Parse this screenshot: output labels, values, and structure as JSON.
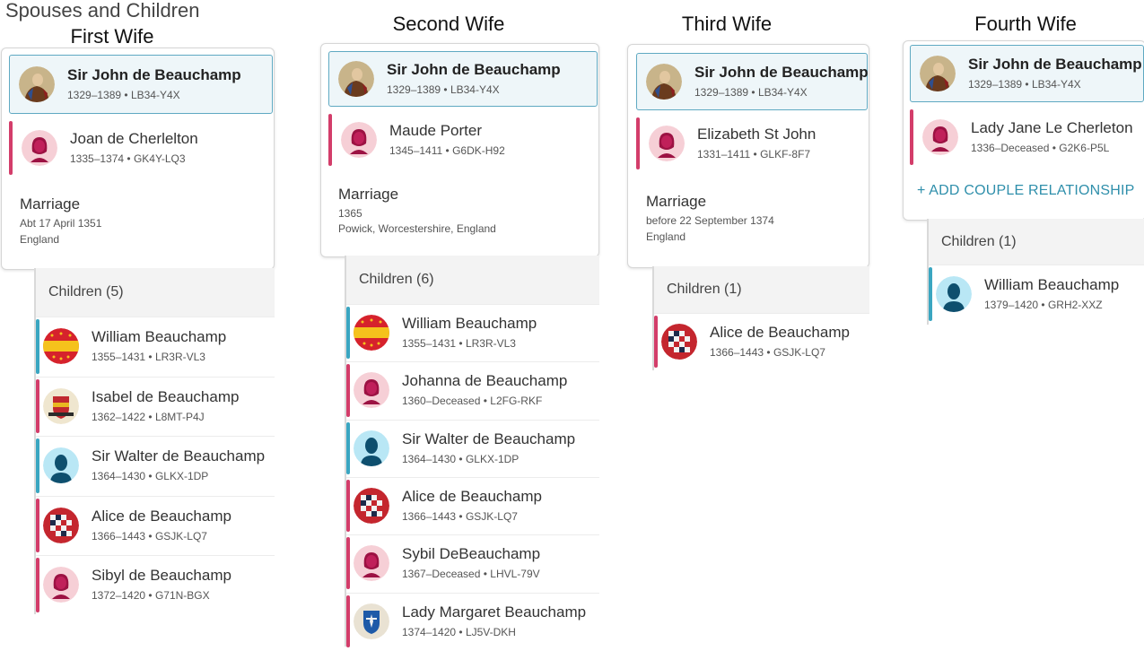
{
  "page_title": "Spouses and Children",
  "colors": {
    "female": "#d33d6a",
    "male": "#3aa6c1",
    "link": "#2f8fab",
    "focus_border": "#5fa9c2"
  },
  "columns": [
    {
      "title": "First Wife",
      "focus": {
        "name": "Sir John de Beauchamp",
        "years": "1329–1389",
        "id": "LB34-Y4X",
        "avatar": "portrait-icon"
      },
      "spouse": {
        "name": "Joan de Cherlelton",
        "years": "1335–1374",
        "id": "GK4Y-LQ3",
        "avatar": "female-silhouette-icon"
      },
      "marriage": {
        "label": "Marriage",
        "date": "Abt 17 April 1351",
        "place": "England"
      },
      "children_label": "Children (5)",
      "children": [
        {
          "name": "William Beauchamp",
          "years": "1355–1431",
          "id": "LR3R-VL3",
          "gender": "male",
          "avatar": "coat-of-arms-icon"
        },
        {
          "name": "Isabel de Beauchamp",
          "years": "1362–1422",
          "id": "L8MT-P4J",
          "gender": "female",
          "avatar": "heraldic-crest-icon"
        },
        {
          "name": "Sir Walter de Beauchamp",
          "years": "1364–1430",
          "id": "GLKX-1DP",
          "gender": "male",
          "avatar": "male-silhouette-icon"
        },
        {
          "name": "Alice de Beauchamp",
          "years": "1366–1443",
          "id": "GSJK-LQ7",
          "gender": "female",
          "avatar": "checkered-shield-icon"
        },
        {
          "name": "Sibyl de Beauchamp",
          "years": "1372–1420",
          "id": "G71N-BGX",
          "gender": "female",
          "avatar": "female-silhouette-icon"
        }
      ]
    },
    {
      "title": "Second Wife",
      "focus": {
        "name": "Sir John de Beauchamp",
        "years": "1329–1389",
        "id": "LB34-Y4X",
        "avatar": "portrait-icon"
      },
      "spouse": {
        "name": "Maude Porter",
        "years": "1345–1411",
        "id": "G6DK-H92",
        "avatar": "female-silhouette-icon"
      },
      "marriage": {
        "label": "Marriage",
        "date": "1365",
        "place": "Powick, Worcestershire, England"
      },
      "children_label": "Children (6)",
      "children": [
        {
          "name": "William Beauchamp",
          "years": "1355–1431",
          "id": "LR3R-VL3",
          "gender": "male",
          "avatar": "coat-of-arms-icon"
        },
        {
          "name": "Johanna de Beauchamp",
          "years": "1360–Deceased",
          "id": "L2FG-RKF",
          "gender": "female",
          "avatar": "female-silhouette-icon"
        },
        {
          "name": "Sir Walter de Beauchamp",
          "years": "1364–1430",
          "id": "GLKX-1DP",
          "gender": "male",
          "avatar": "male-silhouette-icon"
        },
        {
          "name": "Alice de Beauchamp",
          "years": "1366–1443",
          "id": "GSJK-LQ7",
          "gender": "female",
          "avatar": "checkered-shield-icon"
        },
        {
          "name": "Sybil DeBeauchamp",
          "years": "1367–Deceased",
          "id": "LHVL-79V",
          "gender": "female",
          "avatar": "female-silhouette-icon"
        },
        {
          "name": "Lady Margaret Beauchamp",
          "years": "1374–1420",
          "id": "LJ5V-DKH",
          "gender": "female",
          "avatar": "blue-crest-icon"
        }
      ]
    },
    {
      "title": "Third Wife",
      "focus": {
        "name": "Sir John de Beauchamp",
        "years": "1329–1389",
        "id": "LB34-Y4X",
        "avatar": "portrait-icon"
      },
      "spouse": {
        "name": "Elizabeth St John",
        "years": "1331–1411",
        "id": "GLKF-8F7",
        "avatar": "female-silhouette-icon"
      },
      "marriage": {
        "label": "Marriage",
        "date": "before 22 September 1374",
        "place": "England"
      },
      "children_label": "Children (1)",
      "children": [
        {
          "name": "Alice de Beauchamp",
          "years": "1366–1443",
          "id": "GSJK-LQ7",
          "gender": "female",
          "avatar": "checkered-shield-icon"
        }
      ]
    },
    {
      "title": "Fourth Wife",
      "focus": {
        "name": "Sir John de Beauchamp",
        "years": "1329–1389",
        "id": "LB34-Y4X",
        "avatar": "portrait-icon"
      },
      "spouse": {
        "name": "Lady Jane Le Cherleton",
        "years": "1336–Deceased",
        "id": "G2K6-P5L",
        "avatar": "female-silhouette-icon"
      },
      "add_relationship": "+ ADD COUPLE RELATIONSHIP",
      "children_label": "Children (1)",
      "children": [
        {
          "name": "William Beauchamp",
          "years": "1379–1420",
          "id": "GRH2-XXZ",
          "gender": "male",
          "avatar": "male-silhouette-icon"
        }
      ]
    }
  ]
}
